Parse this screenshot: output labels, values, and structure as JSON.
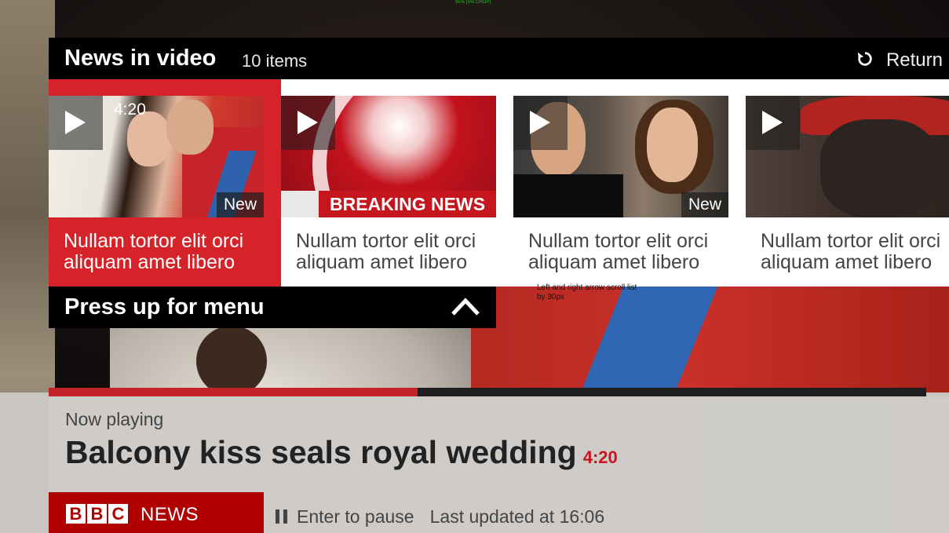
{
  "header": {
    "title": "News in video",
    "count": "10 items",
    "return_label": "Return"
  },
  "debug_text": "95% (5% CROP)",
  "note_text": "Left and right arrow scroll list by 30px",
  "cards": [
    {
      "caption": "Nullam tortor elit orci aliquam amet libero",
      "duration": "4:20",
      "badge": "New",
      "selected": true
    },
    {
      "caption": "Nullam tortor elit orci aliquam amet libero",
      "overlay": "BREAKING NEWS"
    },
    {
      "caption": "Nullam tortor elit orci aliquam amet libero",
      "badge": "New"
    },
    {
      "caption": "Nullam tortor elit orci aliquam amet libero"
    }
  ],
  "menu_hint": "Press up for menu",
  "progress_fraction": 0.42,
  "now_playing": {
    "label": "Now playing",
    "headline": "Balcony kiss seals royal wedding",
    "duration": "4:20",
    "pause_hint": "Enter to pause",
    "last_updated": "Last updated at 16:06"
  },
  "brand": {
    "letters": [
      "B",
      "B",
      "C"
    ],
    "word": "NEWS"
  },
  "icons": {
    "return": "return-icon",
    "play": "play-icon",
    "up": "chevron-up-icon",
    "pause": "pause-icon"
  },
  "colors": {
    "accent": "#d62329",
    "brand": "#b00000"
  }
}
